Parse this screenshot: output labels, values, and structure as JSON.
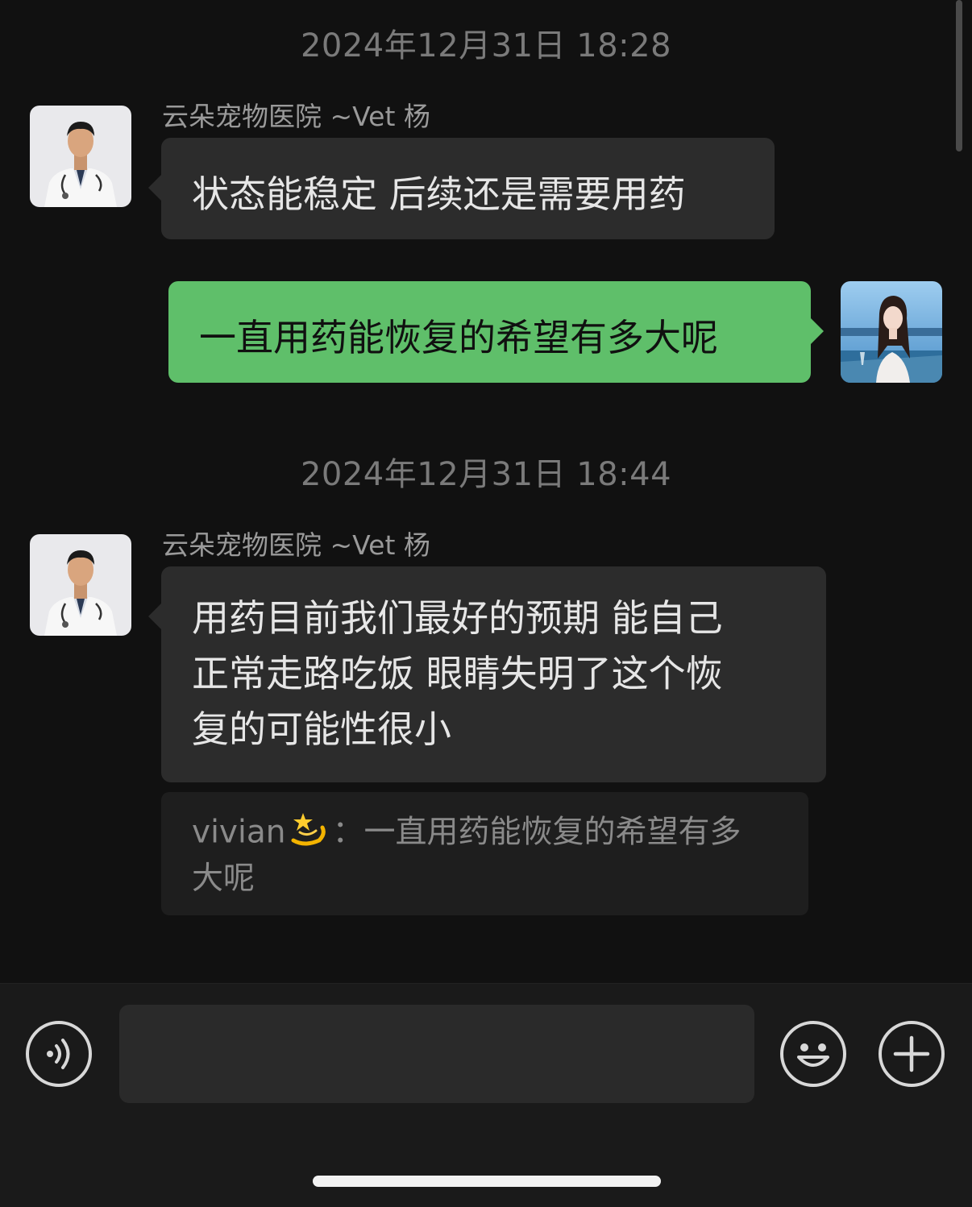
{
  "chat": {
    "timestamps": [
      "2024年12月31日 18:28",
      "2024年12月31日 18:44"
    ],
    "contact_name": "云朵宠物医院 ~Vet 杨",
    "messages": [
      {
        "from": "contact",
        "text": "状态能稳定 后续还是需要用药"
      },
      {
        "from": "me",
        "text": "一直用药能恢复的希望有多大呢"
      },
      {
        "from": "contact",
        "lines": [
          "用药目前我们最好的预期 能自己",
          "正常走路吃饭  眼睛失明了这个恢",
          "复的可能性很小"
        ]
      }
    ],
    "quote": {
      "author": "vivian",
      "author_emoji": "dizzy-star-emoji",
      "separator": "：",
      "text_line1": "一直用药能恢复的希望有多",
      "text_line2": "大呢"
    }
  },
  "input_bar": {
    "voice_icon": "voice-icon",
    "input_value": "",
    "emoji_icon": "emoji-face-icon",
    "plus_icon": "plus-icon"
  },
  "colors": {
    "background": "#111111",
    "incoming_bubble": "#2c2c2c",
    "outgoing_bubble": "#5fbf6a",
    "timestamp": "#7a7a7a"
  }
}
